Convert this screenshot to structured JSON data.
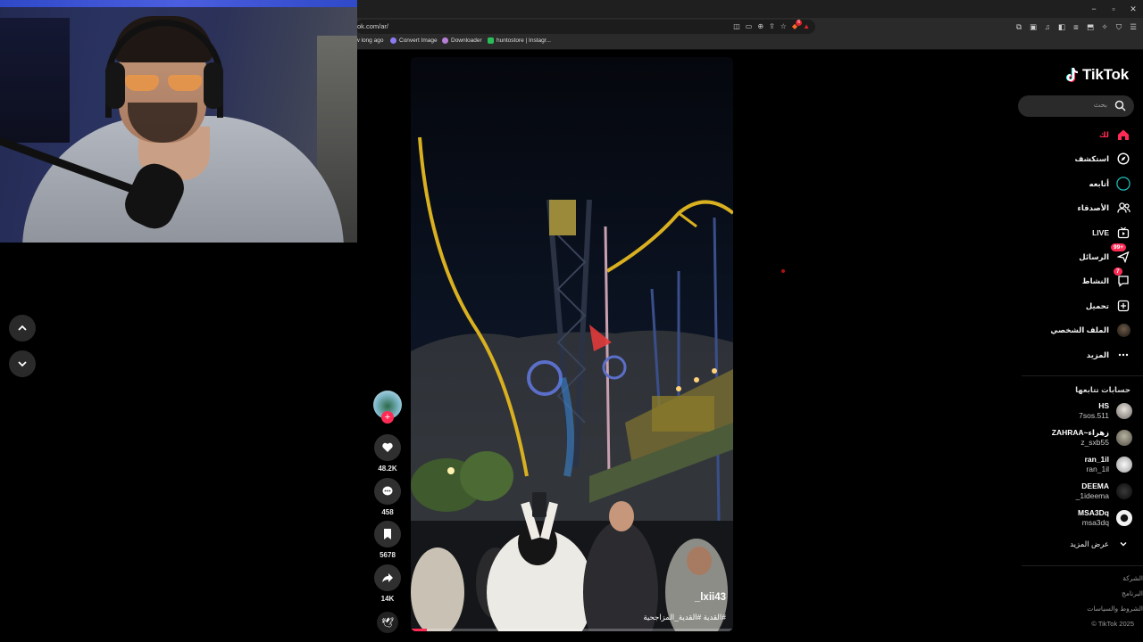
{
  "browser": {
    "url": "ok.com/ar/",
    "bookmarks": [
      {
        "label": "w long ago",
        "color": "#00000000"
      },
      {
        "label": "Convert Image",
        "color": "#8a7cf0"
      },
      {
        "label": "Downloader",
        "color": "#b87fd8"
      },
      {
        "label": "huntostore | Instagr...",
        "color": "#2bbd5a"
      }
    ],
    "shields_count": "6",
    "window_controls": [
      "−",
      "▫",
      "✕"
    ]
  },
  "video": {
    "username": "_lxii43",
    "caption": "#القدية #القدية_المزاجحية",
    "progress": 0.05
  },
  "actions": {
    "likes": "48.2K",
    "comments": "458",
    "saves": "5678",
    "shares": "14K"
  },
  "sidebar": {
    "logo": "TikTok",
    "search_placeholder": "بحث",
    "nav": [
      {
        "label": "لك",
        "icon": "home-icon",
        "active": true
      },
      {
        "label": "استكشف",
        "icon": "compass-icon"
      },
      {
        "label": "أتابعه",
        "icon": "following-ring-icon"
      },
      {
        "label": "الأصدقاء",
        "icon": "friends-icon"
      },
      {
        "label": "LIVE",
        "icon": "live-icon"
      },
      {
        "label": "الرسائل",
        "icon": "messages-icon",
        "badge": "99+"
      },
      {
        "label": "النشاط",
        "icon": "activity-icon",
        "badge": "7"
      },
      {
        "label": "تحميل",
        "icon": "upload-icon"
      },
      {
        "label": "الملف الشخصي",
        "icon": "profile-avatar-icon"
      },
      {
        "label": "المزيد",
        "icon": "more-icon"
      }
    ],
    "following_title": "حسابات تتابعها",
    "following": [
      {
        "name": "HS",
        "handle": "7sos.511",
        "color": "#cfc6c0"
      },
      {
        "name": "ZAHRAA~زهراء",
        "handle": "z_sxb55",
        "color": "#8c8c80"
      },
      {
        "name": "ran_1il",
        "handle": "ran_1il",
        "color": "#e8e8e8"
      },
      {
        "name": "DEEMA",
        "handle": "_1ideema",
        "color": "#1a1a1a"
      },
      {
        "name": "MSA3Dq",
        "handle": "msa3dq",
        "color": "#f2f2f2"
      }
    ],
    "see_more": "عرض المزيد",
    "footer": [
      "الشركة",
      "البرنامج",
      "الشروط والسياسات",
      "© TikTok 2025"
    ]
  }
}
